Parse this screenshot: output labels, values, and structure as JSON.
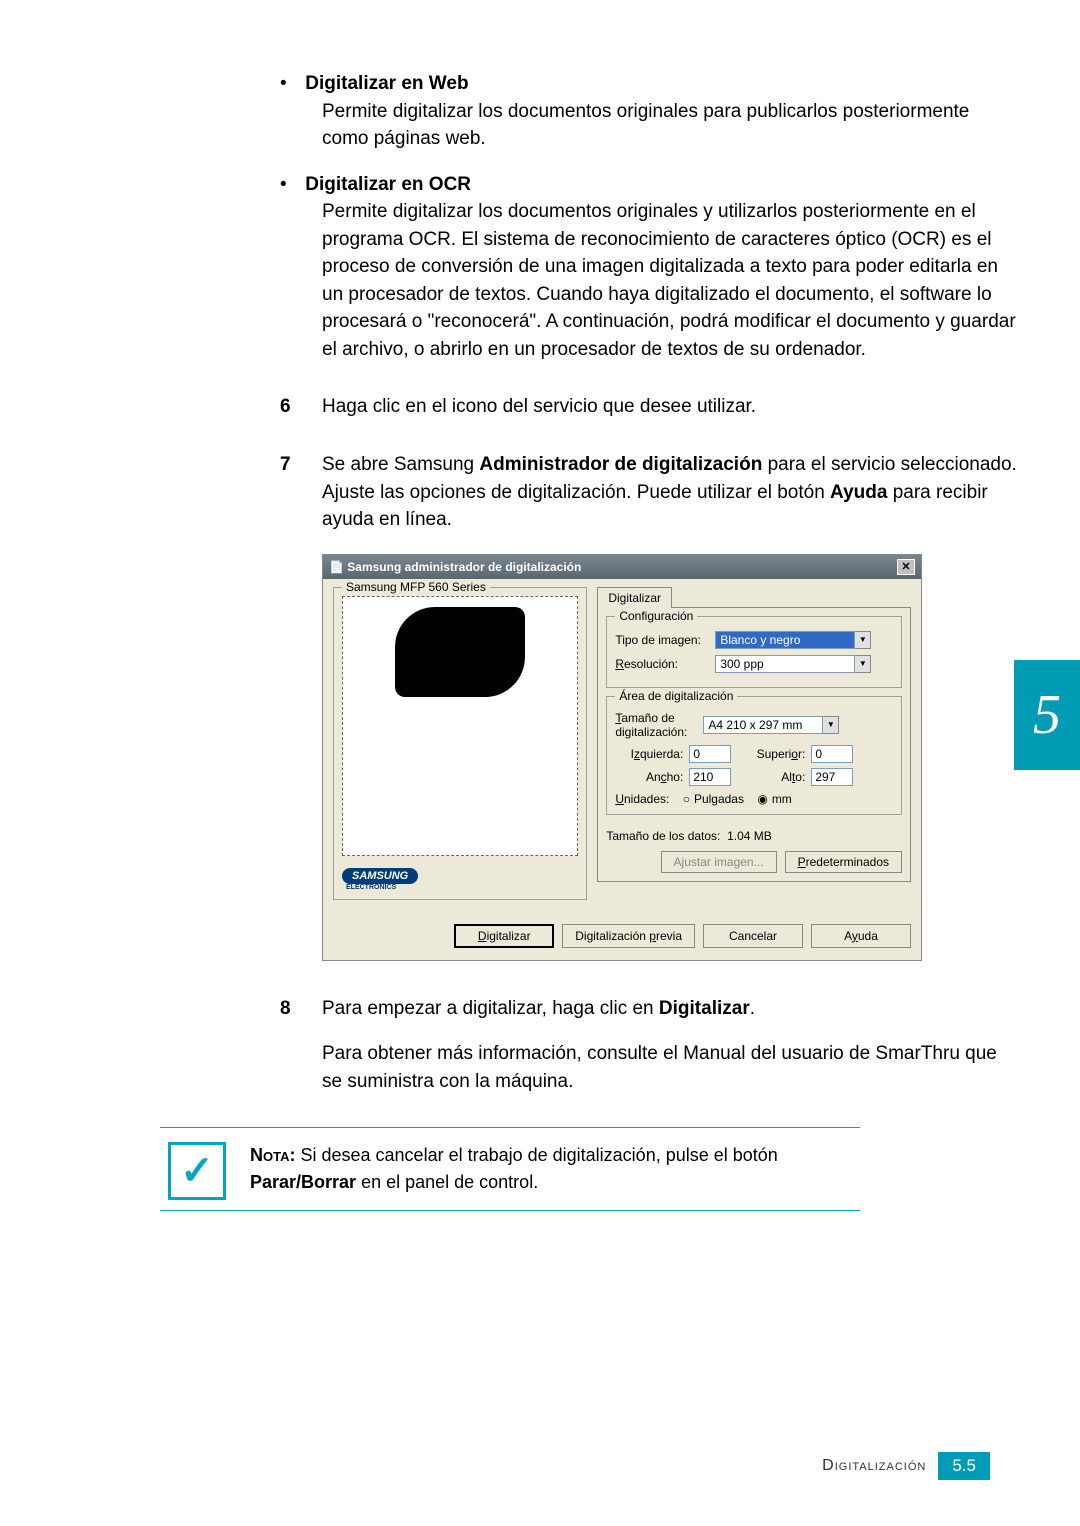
{
  "bullets": [
    {
      "title": "Digitalizar en Web",
      "desc": "Permite digitalizar los documentos originales para publicarlos posteriormente como páginas web."
    },
    {
      "title": "Digitalizar en OCR",
      "desc": "Permite digitalizar los documentos originales y utilizarlos posteriormente en el programa OCR. El sistema de reconocimiento de caracteres óptico (OCR) es el proceso de conversión de una imagen digitalizada a texto para poder editarla en un procesador de textos. Cuando haya digitalizado el documento, el software lo procesará o \"reconocerá\". A continuación, podrá modificar el documento y guardar el archivo, o abrirlo en un procesador de textos de su ordenador."
    }
  ],
  "steps": {
    "s6": {
      "num": "6",
      "text": "Haga clic en el icono del servicio que desee utilizar."
    },
    "s7": {
      "num": "7",
      "pre": "Se abre Samsung ",
      "bold1": "Administrador de digitalización",
      "mid": " para el servicio seleccionado. Ajuste las opciones de digitalización. Puede utilizar el botón ",
      "bold2": "Ayuda",
      "post": " para recibir ayuda en línea."
    },
    "s8": {
      "num": "8",
      "pre": "Para empezar a digitalizar, haga clic en ",
      "bold": "Digitalizar",
      "post": ".",
      "extra": "Para obtener más información, consulte el Manual del usuario de SmarThru que se suministra con la máquina."
    }
  },
  "dialog": {
    "title": "Samsung administrador de digitalización",
    "device_group": "Samsung MFP 560 Series",
    "logo": "SAMSUNG",
    "logo_sub": "ELECTRONICS",
    "tab": "Digitalizar",
    "config_group": "Configuración",
    "img_type_label": "Tipo de imagen:",
    "img_type_value": "Blanco y negro",
    "res_label": "Resolución:",
    "res_value": "300 ppp",
    "area_group": "Área de digitalización",
    "scan_size_label": "Tamaño de digitalización:",
    "scan_size_value": "A4 210 x 297 mm",
    "left_label": "Izquierda:",
    "left_value": "0",
    "top_label": "Superior:",
    "top_value": "0",
    "width_label": "Ancho:",
    "width_value": "210",
    "height_label": "Alto:",
    "height_value": "297",
    "units_label": "Unidades:",
    "units_inches": "Pulgadas",
    "units_mm": "mm",
    "data_size_label": "Tamaño de los datos:",
    "data_size_value": "1.04 MB",
    "adjust_btn": "Ajustar imagen...",
    "defaults_btn": "Predeterminados",
    "scan_btn": "Digitalizar",
    "preview_btn": "Digitalización previa",
    "cancel_btn": "Cancelar",
    "help_btn": "Ayuda"
  },
  "note": {
    "label": "Nota:",
    "pre": " Si desea cancelar el trabajo de digitalización, pulse el botón ",
    "bold": "Parar/Borrar",
    "post": " en el panel de control."
  },
  "side_tab": "5",
  "footer": {
    "label": "Digitalización",
    "page": "5.5"
  }
}
